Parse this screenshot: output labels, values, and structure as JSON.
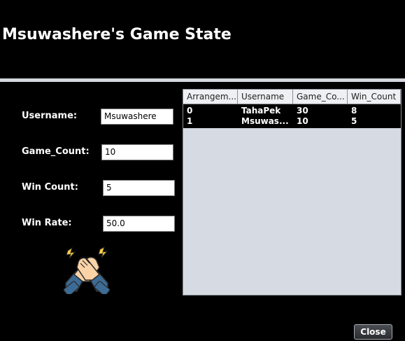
{
  "window": {
    "title": "Msuwashere's Game State"
  },
  "form": {
    "username_label": "Username:",
    "username_value": "Msuwashere",
    "game_count_label": "Game_Count:",
    "game_count_value": "10",
    "win_count_label": "Win Count:",
    "win_count_value": "5",
    "win_rate_label": "Win Rate:",
    "win_rate_value": "50.0"
  },
  "icon": {
    "name": "handshake-icon",
    "colors": {
      "skin": "#fbd3a7",
      "sleeve": "#3d6b96",
      "spark": "#ffd23f",
      "outline": "#2a2a2a"
    }
  },
  "table": {
    "columns": [
      "Arrangem...",
      "Username",
      "Game_Co...",
      "Win_Count"
    ],
    "rows": [
      [
        "0",
        "TahaPek",
        "30",
        "8"
      ],
      [
        "1",
        "Msuwas...",
        "10",
        "5"
      ]
    ]
  },
  "footer": {
    "close_label": "Close"
  }
}
